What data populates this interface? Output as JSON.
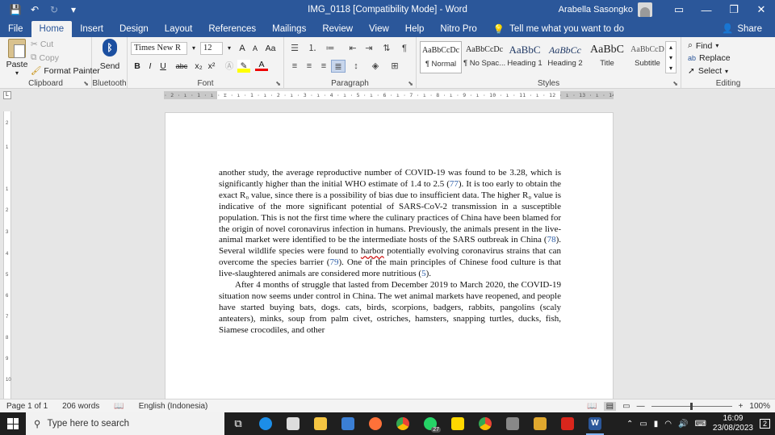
{
  "window": {
    "title": "IMG_0118 [Compatibility Mode]  -  Word",
    "user": "Arabella Sasongko"
  },
  "tabs": [
    "File",
    "Home",
    "Insert",
    "Design",
    "Layout",
    "References",
    "Mailings",
    "Review",
    "View",
    "Help",
    "Nitro Pro"
  ],
  "active_tab": "Home",
  "tell_me": "Tell me what you want to do",
  "share": "Share",
  "ribbon": {
    "clipboard": {
      "label": "Clipboard",
      "paste": "Paste",
      "cut": "Cut",
      "copy": "Copy",
      "format_painter": "Format Painter"
    },
    "bluetooth": {
      "label": "Bluetooth",
      "send": "Send"
    },
    "font": {
      "label": "Font",
      "name": "Times New R",
      "size": "12",
      "grow": "A",
      "shrink": "A",
      "case": "Aa",
      "bold": "B",
      "italic": "I",
      "underline": "U",
      "strike": "abc",
      "sub": "x₂",
      "sup": "x²"
    },
    "paragraph": {
      "label": "Paragraph"
    },
    "styles": {
      "label": "Styles",
      "items": [
        {
          "sample": "AaBbCcDc",
          "name": "¶ Normal"
        },
        {
          "sample": "AaBbCcDc",
          "name": "¶ No Spac..."
        },
        {
          "sample": "AaBbC",
          "name": "Heading 1"
        },
        {
          "sample": "AaBbCc",
          "name": "Heading 2"
        },
        {
          "sample": "AaBbC",
          "name": "Title"
        },
        {
          "sample": "AaBbCcD",
          "name": "Subtitle"
        }
      ]
    },
    "editing": {
      "label": "Editing",
      "find": "Find",
      "replace": "Replace",
      "select": "Select"
    }
  },
  "ruler": {
    "numbers": "· 2 · ı · 1 · ı · ⌶ · ı · 1 · ı · 2 · ı · 3 · ı · 4 · ı · 5 · ı · 6 · ı · 7 · ı · 8 · ı · 9 · ı · 10 · ı · 11 · ı · 12 · ı · 13 · ı · 14 · ı · 15 · ı · 16 · ı · 17 · ı · 18 ·",
    "vertical": [
      "2",
      "1",
      "1",
      "2",
      "3",
      "4",
      "5",
      "6",
      "7",
      "8",
      "9",
      "10"
    ]
  },
  "document": {
    "p1_a": "another study, the average reproductive number of COVID-19 was found to be 3.28, which is significantly higher than the initial WHO estimate of 1.4 to 2.5 (",
    "ref77": "77",
    "p1_b": "). It is too early to obtain the exact R₀ value, since there is a possibility of bias due to insufficient data. The higher R₀ value is indicative of the more significant potential of SARS-CoV-2 transmission in a susceptible population. This is not the first time where the culinary practices of China have been blamed for the origin of novel coronavirus infection in humans. Previously, the animals present in the live-animal market were identified to be the intermediate hosts of the SARS outbreak in China (",
    "ref78": "78",
    "p1_c": "). Several wildlife species were found to ",
    "harbor": "harbor",
    "p1_d": " potentially evolving coronavirus strains that can overcome the species barrier (",
    "ref79": "79",
    "p1_e": "). One of the main principles of Chinese food culture is that live-slaughtered animals are considered more nutritious (",
    "ref5": "5",
    "p1_f": ").",
    "p2": "After 4 months of struggle that lasted from December 2019 to March 2020, the COVID-19 situation now seems under control in China. The wet animal markets have reopened, and people have started buying bats, dogs. cats, birds, scorpions, badgers, rabbits, pangolins (scaly anteaters), minks, soup from palm civet, ostriches, hamsters, snapping turtles, ducks, fish, Siamese crocodiles, and other"
  },
  "status": {
    "page": "Page 1 of 1",
    "words": "206 words",
    "language": "English (Indonesia)",
    "zoom": "100%",
    "zoom_fraction": 0.5
  },
  "taskbar": {
    "search_placeholder": "Type here to search",
    "whatsapp_badge": "27",
    "time": "16:09",
    "date": "23/08/2023",
    "notifications": "2"
  }
}
